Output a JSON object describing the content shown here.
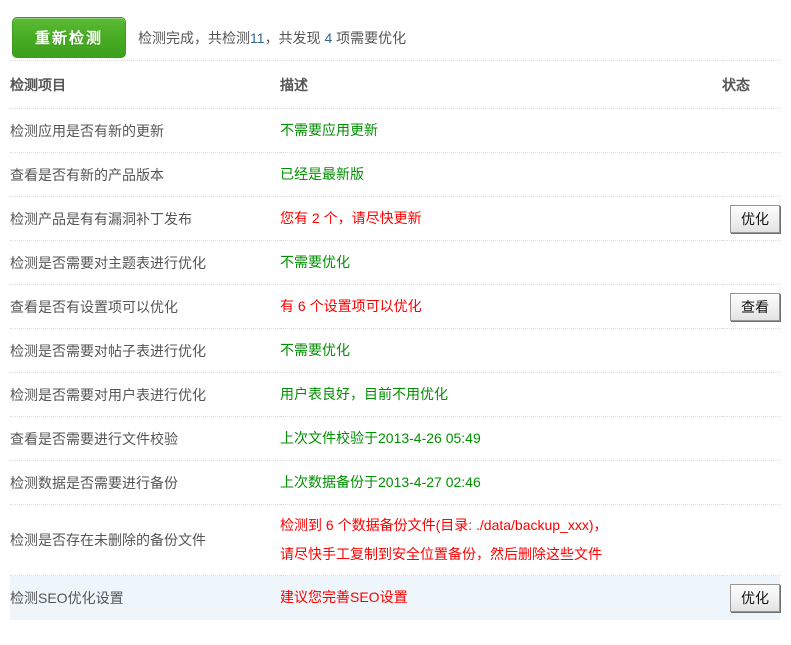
{
  "topbar": {
    "recheck_label": "重新检测",
    "summary": {
      "prefix": "检测完成，共检测",
      "total_checked": "11",
      "middle": "，共发现 ",
      "found_count": "4",
      "suffix": " 项需要优化"
    }
  },
  "table": {
    "headers": {
      "item": "检测项目",
      "description": "描述",
      "status": "状态"
    },
    "rows": [
      {
        "item": "检测应用是否有新的更新",
        "desc": "不需要应用更新",
        "desc_color": "green"
      },
      {
        "item": "查看是否有新的产品版本",
        "desc": "已经是最新版",
        "desc_color": "green"
      },
      {
        "item": "检测产品是有有漏洞补丁发布",
        "desc": "您有 2 个，请尽快更新",
        "desc_color": "red",
        "action": "优化"
      },
      {
        "item": "检测是否需要对主题表进行优化",
        "desc": "不需要优化",
        "desc_color": "green"
      },
      {
        "item": "查看是否有设置项可以优化",
        "desc": "有 6 个设置项可以优化",
        "desc_color": "red",
        "action": "查看"
      },
      {
        "item": "检测是否需要对帖子表进行优化",
        "desc": "不需要优化",
        "desc_color": "green"
      },
      {
        "item": "检测是否需要对用户表进行优化",
        "desc": "用户表良好，目前不用优化",
        "desc_color": "green"
      },
      {
        "item": "查看是否需要进行文件校验",
        "desc": "上次文件校验于2013-4-26 05:49",
        "desc_color": "green"
      },
      {
        "item": "检测数据是否需要进行备份",
        "desc": "上次数据备份于2013-4-27 02:46",
        "desc_color": "green"
      },
      {
        "item": "检测是否存在未删除的备份文件",
        "desc": "检测到 6 个数据备份文件(目录: ./data/backup_xxx)，\n请尽快手工复制到安全位置备份，然后删除这些文件",
        "desc_color": "red"
      },
      {
        "item": "检测SEO优化设置",
        "desc": "建议您完善SEO设置",
        "desc_color": "red",
        "action": "优化",
        "highlighted": true
      }
    ]
  },
  "colors": {
    "accent_green_button": "#48ad24",
    "status_green_text": "#009000",
    "status_red_text": "#fe0000",
    "number_blue": "#336699",
    "divider_dotted": "#ccdfec",
    "highlight_row_bg": "#eef6fb"
  }
}
